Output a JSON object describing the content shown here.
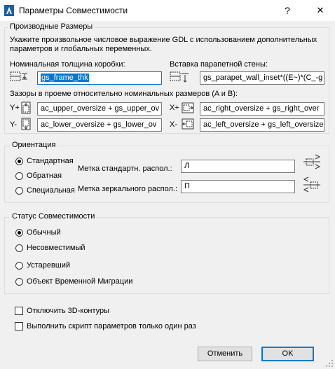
{
  "window": {
    "title": "Параметры Совместимости",
    "help_label": "?",
    "close_label": "✕"
  },
  "derived_sizes": {
    "group_title": "Производные Размеры",
    "description": "Укажите произвольное числовое выражение GDL с использованием дополнительных параметров и глобальных переменных.",
    "nominal_thickness_label": "Номинальная толщина коробки:",
    "nominal_thickness_value": "gs_frame_thk",
    "parapet_inset_label": "Вставка парапетной стены:",
    "parapet_inset_value": "gs_parapet_wall_inset*((E~)*(C_-g",
    "gaps_label": "Зазоры в проеме относительно номинальных размеров (A и B):",
    "upper_prefix": "Y+",
    "upper_value": "ac_upper_oversize + gs_upper_ov",
    "lower_prefix": "Y-",
    "lower_value": "ac_lower_oversize + gs_lower_ov",
    "right_prefix": "X+",
    "right_value": "ac_right_oversize + gs_right_over",
    "left_prefix": "X-",
    "left_value": "ac_left_oversize + gs_left_oversize"
  },
  "orientation": {
    "group_title": "Ориентация",
    "options": [
      "Стандартная",
      "Обратная",
      "Специальная"
    ],
    "selected": "Стандартная",
    "std_tag_label": "Метка стандартн. распол.:",
    "std_tag_value": "Л",
    "mirror_tag_label": "Метка зеркального распол.:",
    "mirror_tag_value": "П"
  },
  "compat_status": {
    "group_title": "Статус Совместимости",
    "options": [
      "Обычный",
      "Несовместимый",
      "Устаревший",
      "Объект Временной Миграции"
    ],
    "selected": "Обычный"
  },
  "checkboxes": {
    "disable_3d": "Отключить 3D-контуры",
    "run_script_once": "Выполнить скрипт параметров только один раз"
  },
  "buttons": {
    "cancel": "Отменить",
    "ok": "OK"
  },
  "colors": {
    "accent": "#0078d7",
    "background": "#f0f0f0"
  }
}
